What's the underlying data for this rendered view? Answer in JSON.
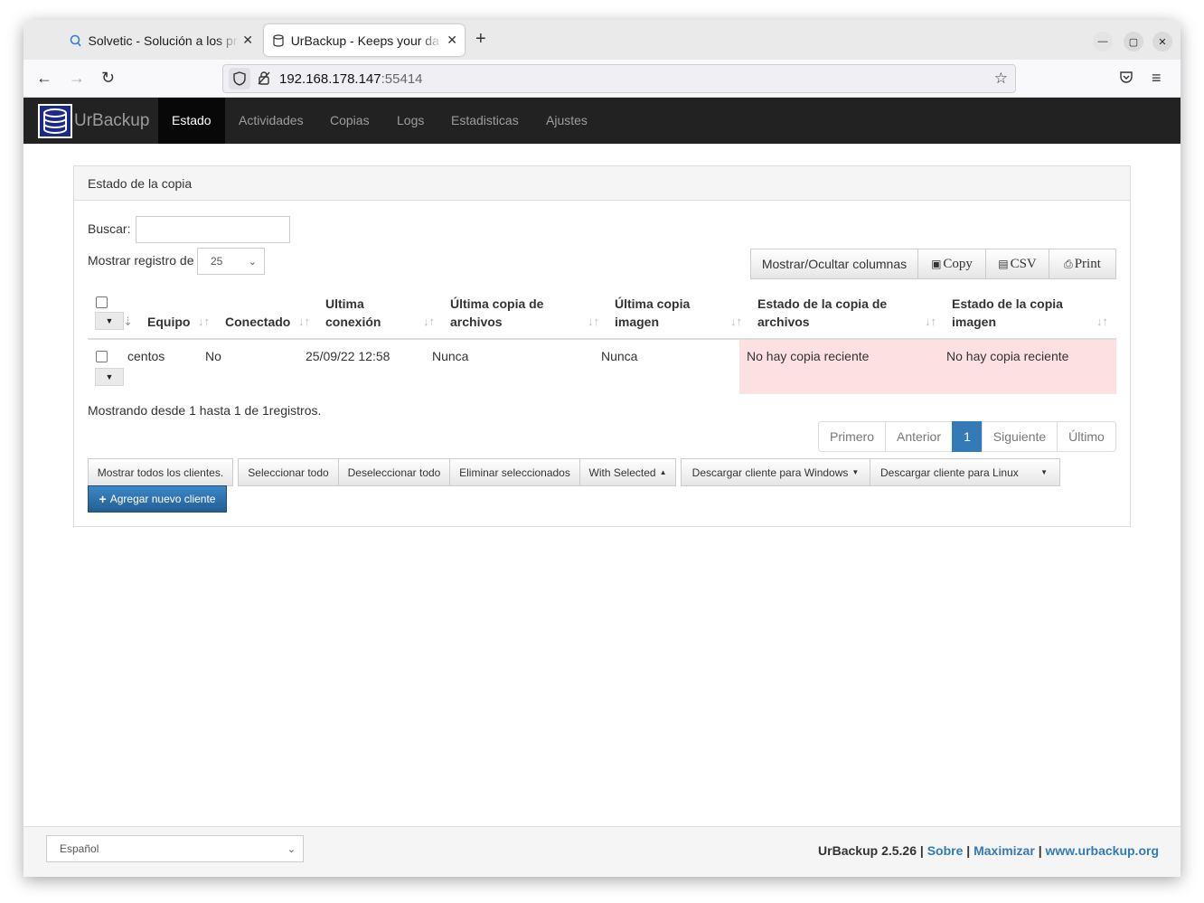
{
  "browser": {
    "tabs": [
      {
        "title": "Solvetic - Solución a los pro",
        "icon": "solvetic-icon",
        "active": false
      },
      {
        "title": "UrBackup - Keeps your da",
        "icon": "database-icon",
        "active": true
      }
    ],
    "url_host": "192.168.178.147",
    "url_port": ":55414"
  },
  "app": {
    "brand": "UrBackup",
    "nav": [
      "Estado",
      "Actividades",
      "Copias",
      "Logs",
      "Estadisticas",
      "Ajustes"
    ],
    "active_nav": "Estado"
  },
  "panel": {
    "title": "Estado de la copia",
    "search_label": "Buscar:",
    "search_value": "",
    "records_label": "Mostrar registro de",
    "records_value": "25",
    "toggle_columns": "Mostrar/Ocultar columnas",
    "export_buttons": [
      "Copy",
      "CSV",
      "Print"
    ]
  },
  "table": {
    "headers": [
      "Equipo",
      "Conectado",
      "Ultima conexión",
      "Última copia de archivos",
      "Última copia imagen",
      "Estado de la copia de archivos",
      "Estado de la copia imagen"
    ],
    "header_lines": {
      "conexion": [
        "Ultima",
        "conexión"
      ],
      "archivos": [
        "Última copia de",
        "archivos"
      ],
      "imagen": [
        "Última copia",
        "imagen"
      ],
      "estado_archivos": [
        "Estado de la copia de",
        "archivos"
      ],
      "estado_imagen": [
        "Estado de la copia",
        "imagen"
      ]
    },
    "rows": [
      {
        "equipo": "centos",
        "conectado": "No",
        "ultima_conexion": "25/09/22 12:58",
        "ultima_archivos": "Nunca",
        "ultima_imagen": "Nunca",
        "estado_archivos": "No hay copia reciente",
        "estado_imagen": "No hay copia reciente"
      }
    ],
    "alert_color": "#fde0e2"
  },
  "info": "Mostrando desde 1 hasta 1 de 1registros.",
  "pagination": [
    "Primero",
    "Anterior",
    "1",
    "Siguiente",
    "Último"
  ],
  "actions": {
    "show_all": "Mostrar todos los clientes.",
    "select_all": "Seleccionar todo",
    "deselect_all": "Deseleccionar todo",
    "delete_selected": "Eliminar seleccionados",
    "with_selected": "With Selected",
    "download_windows": "Descargar cliente para Windows",
    "download_linux": "Descargar cliente para Linux",
    "add_client": "Agregar nuevo cliente"
  },
  "footer": {
    "language": "Español",
    "version": "UrBackup 2.5.26",
    "sep": "|",
    "about": "Sobre",
    "maximize": "Maximizar",
    "website": "www.urbackup.org"
  },
  "colors": {
    "primary": "#337ab7",
    "header_bg": "#222222"
  }
}
